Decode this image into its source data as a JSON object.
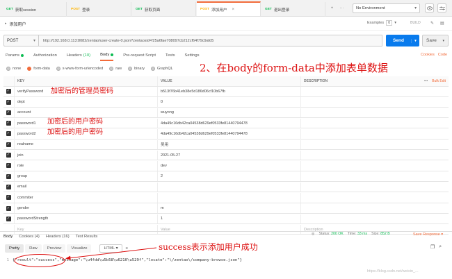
{
  "tabs": [
    {
      "method": "GET",
      "name": "获取session"
    },
    {
      "method": "POST",
      "name": "登录"
    },
    {
      "method": "GET",
      "name": "获取页面"
    },
    {
      "method": "POST",
      "name": "添加用户",
      "active": true
    },
    {
      "method": "GET",
      "name": "退出登录"
    }
  ],
  "environment": "No Environment",
  "request": {
    "name": "添加用户",
    "examples_label": "Examples",
    "examples_count": "0",
    "build_label": "BUILD",
    "method": "POST",
    "url": "http://192.168.0.113:8082/zentao/user-create-0.json?zentaosid=f25a6fae708097cb212cf64f79c9afd5",
    "send_label": "Send",
    "save_label": "Save"
  },
  "request_tabs": {
    "params": "Params",
    "authorization": "Authorization",
    "headers": "Headers",
    "headers_count": "(10)",
    "body": "Body",
    "prerequest": "Pre-request Script",
    "tests": "Tests",
    "settings": "Settings",
    "cookies": "Cookies",
    "code": "Code"
  },
  "body_types": [
    "none",
    "form-data",
    "x-www-form-urlencoded",
    "raw",
    "binary",
    "GraphQL"
  ],
  "table_headers": {
    "key": "KEY",
    "value": "VALUE",
    "description": "DESCRIPTION",
    "bulk_edit": "Bulk Edit"
  },
  "params": [
    {
      "key": "verifyPassword",
      "value": "b513f76b41eb38e5d186d06cf10b67fb"
    },
    {
      "key": "dept",
      "value": "0"
    },
    {
      "key": "account",
      "value": "wuyong"
    },
    {
      "key": "password1",
      "value": "4da49c16db42ca04538d629ef0533fe8144079447​8"
    },
    {
      "key": "password2",
      "value": "4da49c16db42ca04538d629ef0533fe8144079447​8"
    },
    {
      "key": "realname",
      "value": "吴用"
    },
    {
      "key": "join",
      "value": "2021-05-27"
    },
    {
      "key": "role",
      "value": "dev"
    },
    {
      "key": "group",
      "value": "2"
    },
    {
      "key": "email",
      "value": ""
    },
    {
      "key": "commiter",
      "value": ""
    },
    {
      "key": "gender",
      "value": "m"
    },
    {
      "key": "passwordStrength",
      "value": "1"
    }
  ],
  "placeholders": {
    "key": "Key",
    "value": "Value",
    "description": "Description"
  },
  "annotations": {
    "top": "2、在body的form-data中添加表单数据",
    "admin_pwd": "加密后的管理员密码",
    "user_pwd1": "加密后的用户密码",
    "user_pwd2": "加密后的用户密码",
    "success": "success表示添加用户成功"
  },
  "response": {
    "tabs": [
      "Body",
      "Cookies (4)",
      "Headers (16)",
      "Test Results"
    ],
    "status_label": "Status:",
    "status_value": "200 OK",
    "time_label": "Time:",
    "time_value": "33 ms",
    "size_label": "Size:",
    "size_value": "852 B",
    "save_response": "Save Response",
    "views": [
      "Pretty",
      "Raw",
      "Preview",
      "Visualize"
    ],
    "format": "HTML",
    "line_no": "1",
    "body": "{\"result\":\"success\",\"message\":\"\\u4fdd\\u5b58\\u6210\\u529f\",\"locate\":\"\\/zentao\\/company-browse.json\"}"
  },
  "watermark": "https://blog.csdn.net/weixin_..."
}
